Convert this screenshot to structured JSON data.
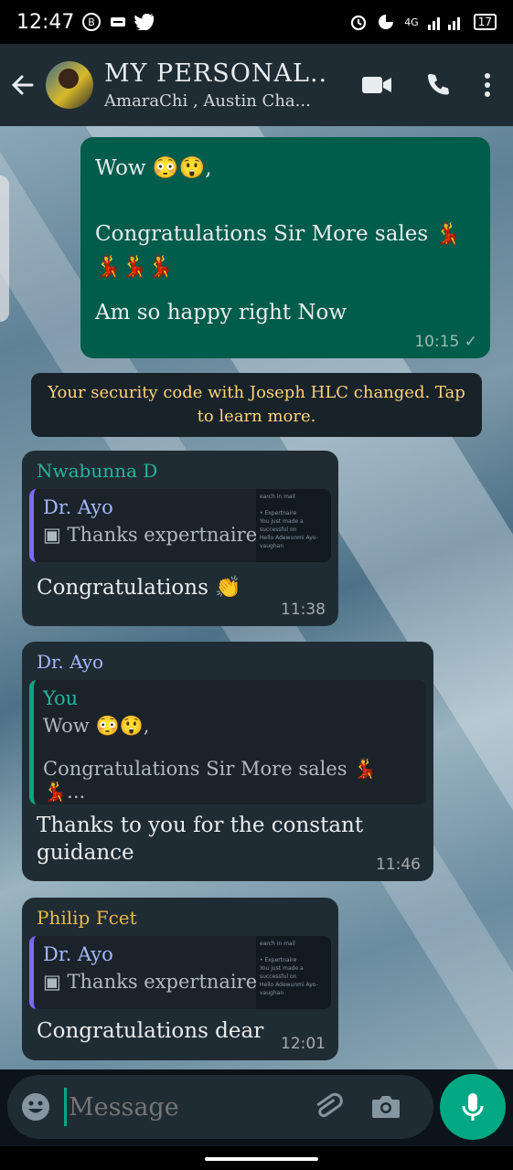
{
  "status_bar": {
    "time": "12:47",
    "network": "4G",
    "battery": "17"
  },
  "header": {
    "title": "MY PERSONAL...",
    "subtitle": "AmaraChi , Austin Cha..."
  },
  "messages": {
    "m1": {
      "line1": "Wow 😳😲,",
      "line2": "Congratulations Sir More sales 💃",
      "line3": "💃💃💃",
      "line4": "Am so happy right Now",
      "time": "10:15 ✓"
    },
    "system": {
      "text": "Your security code with Joseph HLC changed. Tap to learn more."
    },
    "m2": {
      "sender": "Nwabunna D",
      "quote_author": "Dr. Ayo",
      "quote_text": "▣ Thanks expertnaire",
      "thumb_text": "earch in mail\n\n• Expertnaire\nYou just made a successful on\nHello Adewunmi Ayo-vaughan",
      "text": "Congratulations 👏",
      "time": "11:38"
    },
    "m3": {
      "sender": "Dr. Ayo",
      "quote_author": "You",
      "quote_line1": "Wow 😳😲,",
      "quote_line2": "Congratulations Sir More sales 💃💃...",
      "text": "Thanks to you for the constant guidance",
      "time": "11:46"
    },
    "m4": {
      "sender": "Philip Fcet",
      "quote_author": "Dr. Ayo",
      "quote_text": "▣ Thanks expertnaire",
      "thumb_text": "earch in mail\n\n• Expertnaire\nYou just made a successful on\nHello Adewunmi Ayo-vaughan",
      "text": "Congratulations dear",
      "time": "12:01"
    }
  },
  "input": {
    "placeholder": "Message"
  },
  "colors": {
    "outgoing": "#005c4b",
    "incoming": "#202c33",
    "accent": "#00a884",
    "system_text": "#ffd279"
  },
  "icons": [
    "back-arrow-icon",
    "video-call-icon",
    "phone-icon",
    "more-vert-icon",
    "emoji-icon",
    "attach-icon",
    "camera-icon",
    "mic-icon"
  ]
}
